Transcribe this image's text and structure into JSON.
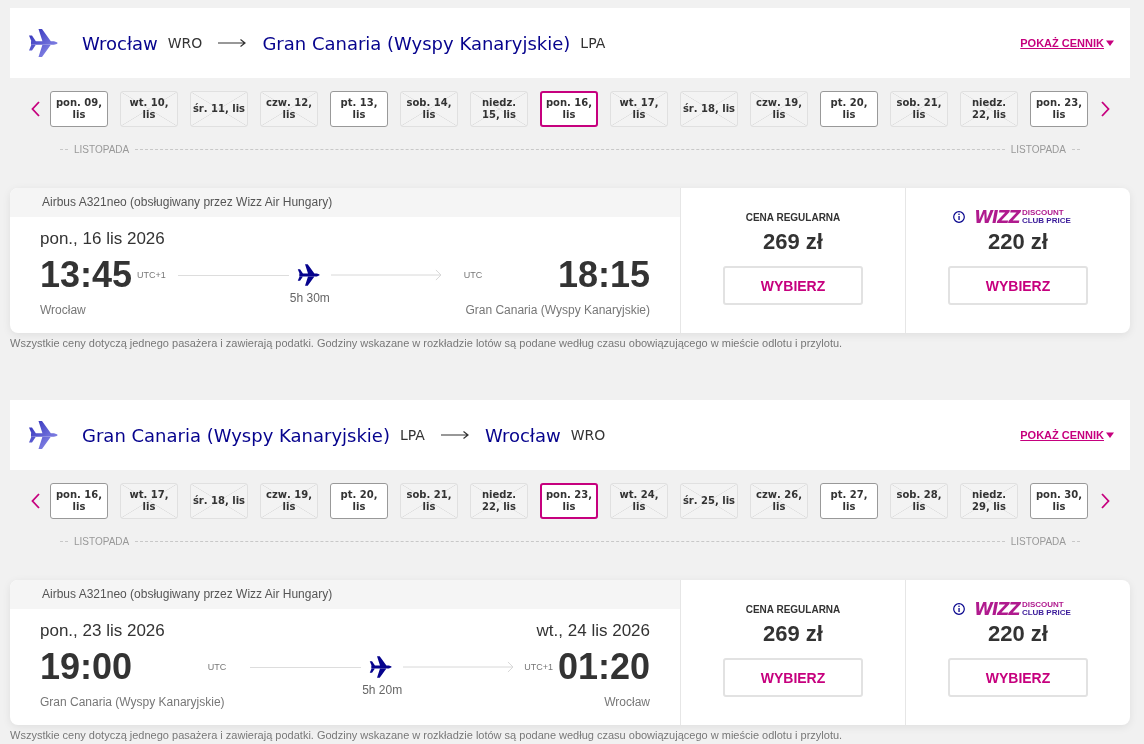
{
  "flights": [
    {
      "header": {
        "origin": {
          "city": "Wrocław",
          "code": "WRO"
        },
        "destination": {
          "city": "Gran Canaria (Wyspy Kanaryjskie)",
          "code": "LPA"
        },
        "price_list_link": "POKAŻ CENNIK"
      },
      "dates": [
        {
          "label": "pon. 09, lis",
          "available": true,
          "selected": false
        },
        {
          "label": "wt. 10, lis",
          "available": false,
          "selected": false
        },
        {
          "label": "śr. 11, lis",
          "available": false,
          "selected": false
        },
        {
          "label": "czw. 12, lis",
          "available": false,
          "selected": false
        },
        {
          "label": "pt. 13, lis",
          "available": true,
          "selected": false
        },
        {
          "label": "sob. 14, lis",
          "available": false,
          "selected": false
        },
        {
          "label": "niedz. 15, lis",
          "available": false,
          "selected": false
        },
        {
          "label": "pon. 16, lis",
          "available": true,
          "selected": true
        },
        {
          "label": "wt. 17, lis",
          "available": false,
          "selected": false
        },
        {
          "label": "śr. 18, lis",
          "available": false,
          "selected": false
        },
        {
          "label": "czw. 19, lis",
          "available": false,
          "selected": false
        },
        {
          "label": "pt. 20, lis",
          "available": true,
          "selected": false
        },
        {
          "label": "sob. 21, lis",
          "available": false,
          "selected": false
        },
        {
          "label": "niedz. 22, lis",
          "available": false,
          "selected": false
        },
        {
          "label": "pon. 23, lis",
          "available": true,
          "selected": false
        }
      ],
      "month_labels": [
        "LISTOPADA",
        "LISTOPADA"
      ],
      "card": {
        "aircraft": "Airbus A321neo (obsługiwany przez Wizz Air Hungary)",
        "departure": {
          "date": "pon., 16 lis 2026",
          "time": "13:45",
          "timezone": "UTC+1",
          "city": "Wrocław"
        },
        "arrival": {
          "time": "18:15",
          "timezone": "UTC",
          "city": "Gran Canaria (Wyspy Kanaryjskie)"
        },
        "duration": "5h 30m",
        "fares": [
          {
            "kind": "regular",
            "label": "CENA REGULARNA",
            "price": "269 zł",
            "button": "WYBIERZ"
          },
          {
            "kind": "club",
            "logo": {
              "wordmark": "WIZZ",
              "line_1": "DISCOUNT",
              "line_2": "CLUB PRICE"
            },
            "price": "220 zł",
            "button": "WYBIERZ"
          }
        ]
      },
      "note": "Wszystkie ceny dotyczą jednego pasażera i zawierają podatki. Godziny wskazane w rozkładzie lotów są podane według czasu obowiązującego w mieście odlotu i przylotu."
    },
    {
      "header": {
        "origin": {
          "city": "Gran Canaria (Wyspy Kanaryjskie)",
          "code": "LPA"
        },
        "destination": {
          "city": "Wrocław",
          "code": "WRO"
        },
        "price_list_link": "POKAŻ CENNIK"
      },
      "dates": [
        {
          "label": "pon. 16, lis",
          "available": true,
          "selected": false
        },
        {
          "label": "wt. 17, lis",
          "available": false,
          "selected": false
        },
        {
          "label": "śr. 18, lis",
          "available": false,
          "selected": false
        },
        {
          "label": "czw. 19, lis",
          "available": false,
          "selected": false
        },
        {
          "label": "pt. 20, lis",
          "available": true,
          "selected": false
        },
        {
          "label": "sob. 21, lis",
          "available": false,
          "selected": false
        },
        {
          "label": "niedz. 22, lis",
          "available": false,
          "selected": false
        },
        {
          "label": "pon. 23, lis",
          "available": true,
          "selected": true
        },
        {
          "label": "wt. 24, lis",
          "available": false,
          "selected": false
        },
        {
          "label": "śr. 25, lis",
          "available": false,
          "selected": false
        },
        {
          "label": "czw. 26, lis",
          "available": false,
          "selected": false
        },
        {
          "label": "pt. 27, lis",
          "available": true,
          "selected": false
        },
        {
          "label": "sob. 28, lis",
          "available": false,
          "selected": false
        },
        {
          "label": "niedz. 29, lis",
          "available": false,
          "selected": false
        },
        {
          "label": "pon. 30, lis",
          "available": true,
          "selected": false
        }
      ],
      "month_labels": [
        "LISTOPADA",
        "LISTOPADA"
      ],
      "card": {
        "aircraft": "Airbus A321neo (obsługiwany przez Wizz Air Hungary)",
        "departure": {
          "date": "pon., 23 lis 2026",
          "time": "19:00",
          "timezone": "UTC",
          "city": "Gran Canaria (Wyspy Kanaryjskie)"
        },
        "arrival": {
          "date": "wt., 24 lis 2026",
          "time": "01:20",
          "timezone": "UTC+1",
          "city": "Wrocław"
        },
        "duration": "5h 20m",
        "fares": [
          {
            "kind": "regular",
            "label": "CENA REGULARNA",
            "price": "269 zł",
            "button": "WYBIERZ"
          },
          {
            "kind": "club",
            "logo": {
              "wordmark": "WIZZ",
              "line_1": "DISCOUNT",
              "line_2": "CLUB PRICE"
            },
            "price": "220 zł",
            "button": "WYBIERZ"
          }
        ]
      },
      "note": "Wszystkie ceny dotyczą jednego pasażera i zawierają podatki. Godziny wskazane w rozkładzie lotów są podane według czasu obowiązującego w mieście odlotu i przylotu."
    }
  ]
}
